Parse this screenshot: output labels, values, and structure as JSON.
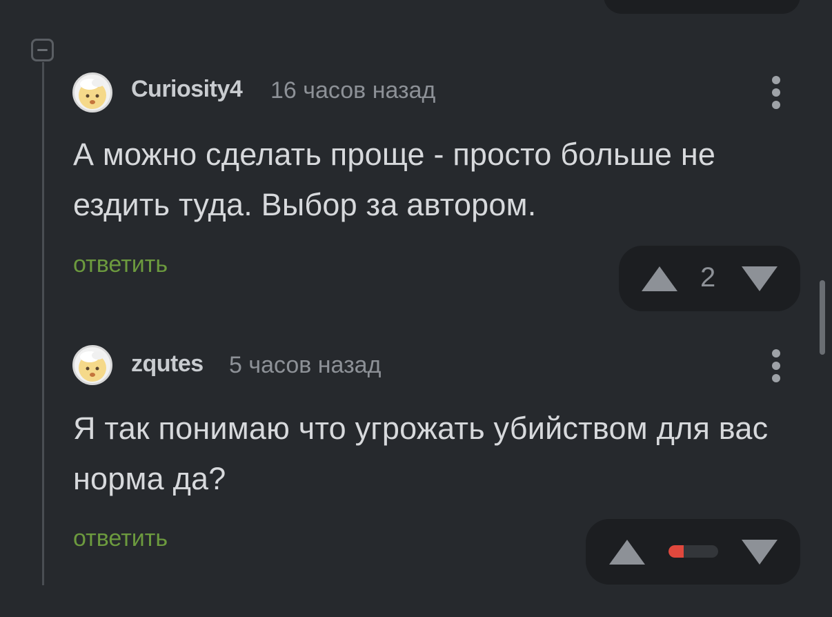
{
  "comments": [
    {
      "username": "Curiosity4",
      "time": "16 часов назад",
      "text": "А можно сделать проще - просто больше не ездить туда. Выбор за автором.",
      "reply_label": "ответить",
      "score": "2"
    },
    {
      "username": "zqutes",
      "time": "5 часов назад",
      "text": "Я так понимаю что угрожать убийством для вас норма да?",
      "reply_label": "ответить",
      "rating_fraction": 0.3
    }
  ],
  "colors": {
    "background": "#26292d",
    "reply": "#6c9a3e",
    "negative_rating": "#e0483d"
  },
  "icons": [
    "collapse-icon",
    "avatar",
    "more-vertical-icon",
    "upvote-arrow-icon",
    "downvote-arrow-icon"
  ]
}
